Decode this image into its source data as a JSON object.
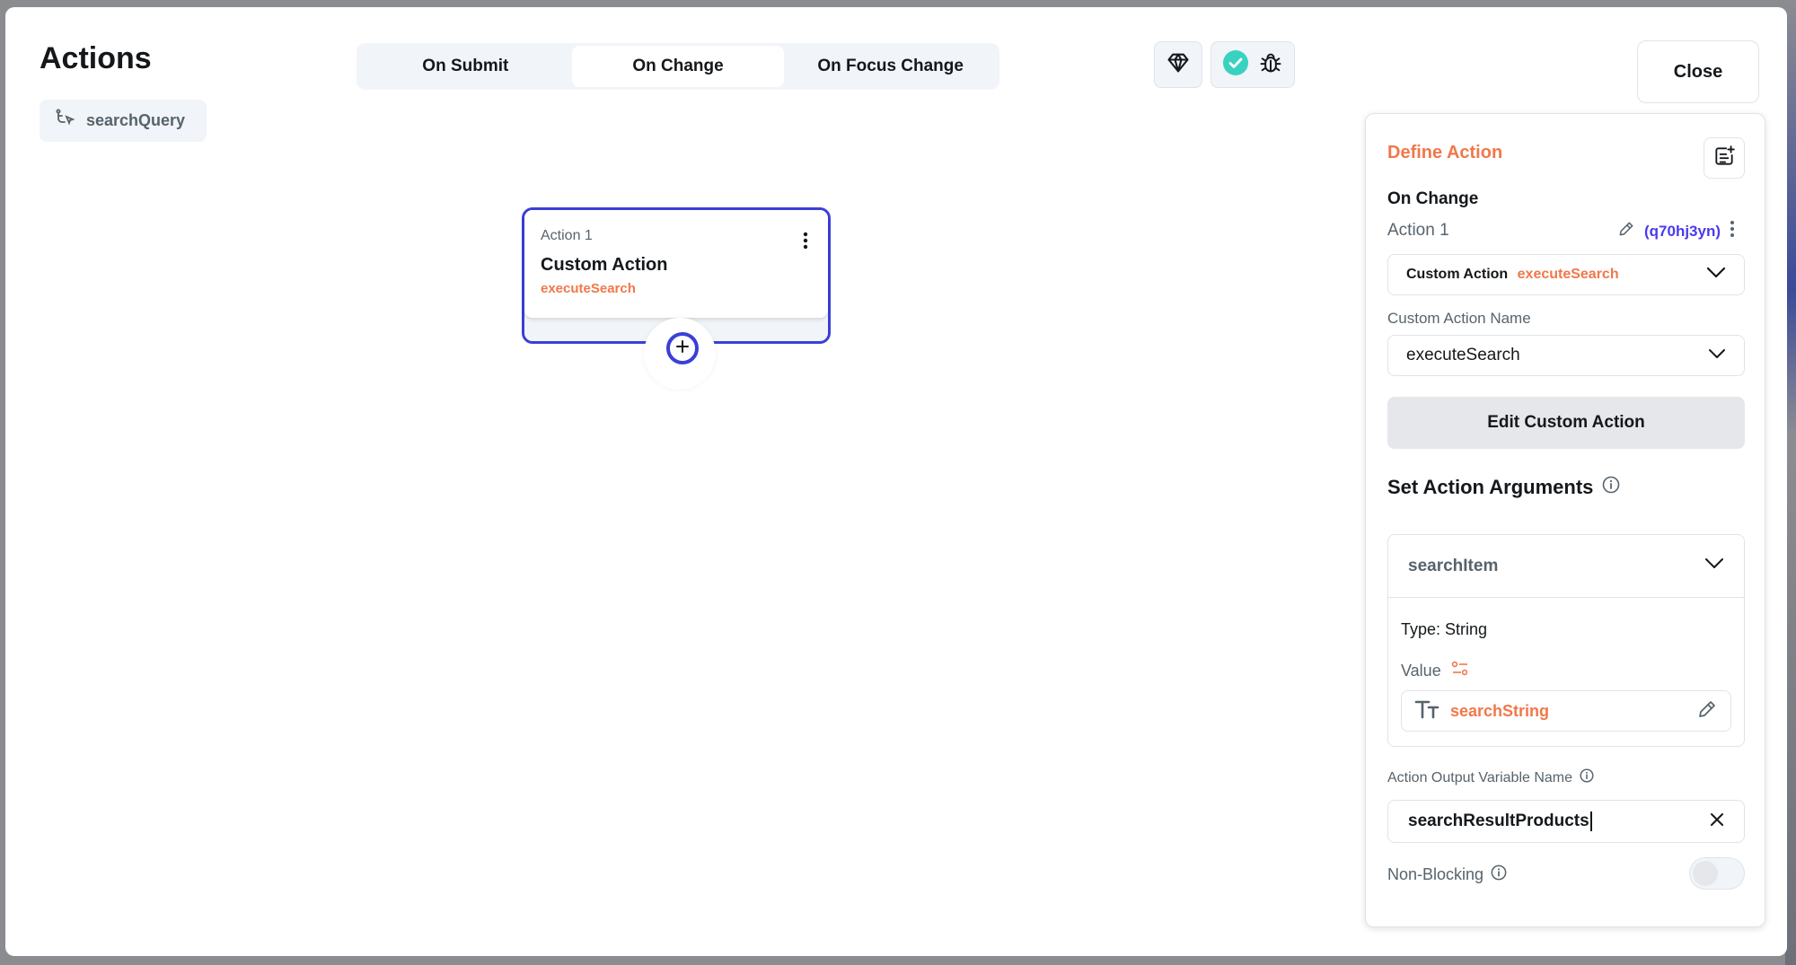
{
  "header": {
    "title": "Actions",
    "widget_chip": "searchQuery"
  },
  "tabs": [
    {
      "label": "On Submit",
      "active": false
    },
    {
      "label": "On Change",
      "active": true
    },
    {
      "label": "On Focus Change",
      "active": false
    }
  ],
  "toolbar": {
    "close_label": "Close",
    "icons": [
      "ai-agent-icon",
      "validation-ok-icon",
      "debug-bug-icon"
    ]
  },
  "node": {
    "index_label": "Action 1",
    "type_label": "Custom Action",
    "action_name": "executeSearch"
  },
  "panel": {
    "title": "Define Action",
    "trigger": "On Change",
    "action_label": "Action 1",
    "action_id": "(q70hj3yn)",
    "action_type": "Custom Action",
    "action_type_value": "executeSearch",
    "custom_action_name_label": "Custom Action Name",
    "custom_action_name_value": "executeSearch",
    "edit_button": "Edit Custom Action",
    "set_args_title": "Set Action Arguments",
    "argument": {
      "name": "searchItem",
      "type": "Type: String",
      "value_label": "Value",
      "value": "searchString"
    },
    "output_label": "Action Output Variable Name",
    "output_value": "searchResultProducts",
    "non_blocking_label": "Non-Blocking",
    "non_blocking_on": false
  },
  "colors": {
    "accent_orange": "#f0784a",
    "accent_blue": "#3b3fd8",
    "success_green": "#39d2c0"
  }
}
